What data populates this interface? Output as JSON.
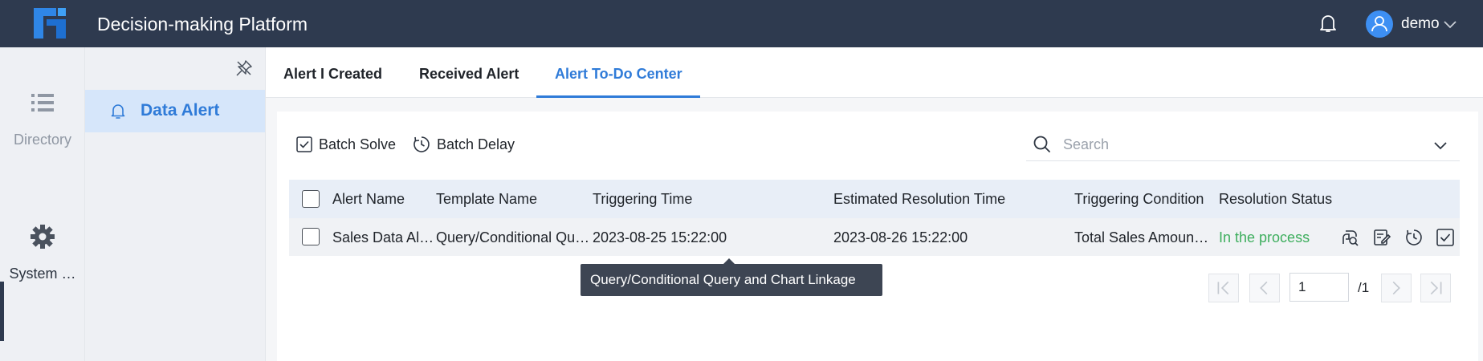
{
  "header": {
    "app_title": "Decision-making Platform",
    "username": "demo"
  },
  "rail": {
    "items": [
      {
        "label": "Directory"
      },
      {
        "label": "System …"
      }
    ]
  },
  "subnav": {
    "items": [
      {
        "label": "Data Alert"
      }
    ]
  },
  "tabs": [
    {
      "label": "Alert I Created"
    },
    {
      "label": "Received Alert"
    },
    {
      "label": "Alert To-Do Center"
    }
  ],
  "toolbar": {
    "batch_solve": "Batch Solve",
    "batch_delay": "Batch Delay",
    "search_placeholder": "Search"
  },
  "table": {
    "columns": [
      "Alert Name",
      "Template Name",
      "Triggering Time",
      "Estimated Resolution Time",
      "Triggering Condition",
      "Resolution Status"
    ],
    "rows": [
      {
        "alert_name": "Sales Data Alert",
        "template_name": "Query/Conditional Qu…",
        "triggering_time": "2023-08-25 15:22:00",
        "estimated_resolution_time": "2023-08-26 15:22:00",
        "triggering_condition": "Total Sales Amount…",
        "resolution_status": "In the process"
      }
    ]
  },
  "tooltip": "Query/Conditional Query and Chart Linkage",
  "pagination": {
    "current_page": "1",
    "total": "/1"
  },
  "colors": {
    "topbar": "#2e3a4f",
    "accent": "#2f7bd8",
    "status_in_process": "#3dae5d"
  }
}
